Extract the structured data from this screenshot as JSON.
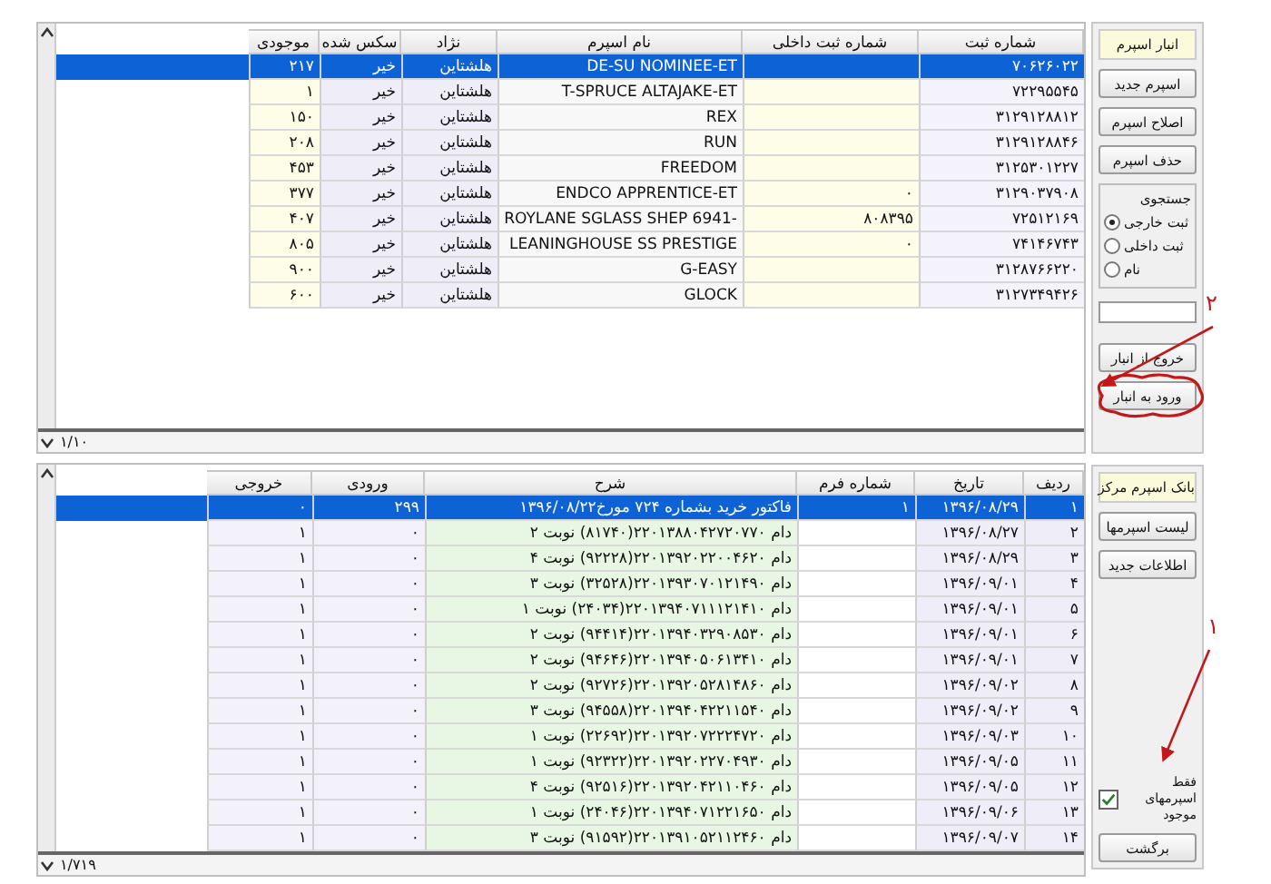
{
  "upper_grid": {
    "columns": [
      "شماره ثبت",
      "شماره ثبت داخلی",
      "نام اسپرم",
      "نژاد",
      "سکس شده",
      "موجودی"
    ],
    "rows": [
      {
        "selected": true,
        "cells": [
          "۷۰۶۲۶۰۲۲",
          "",
          "DE-SU NOMINEE-ET",
          "هلشتاین",
          "خیر",
          "۲۱۷"
        ]
      },
      {
        "selected": false,
        "cells": [
          "۷۲۲۹۵۵۴۵",
          "",
          "T-SPRUCE ALTAJAKE-ET",
          "هلشتاین",
          "خیر",
          "۱"
        ]
      },
      {
        "selected": false,
        "cells": [
          "۳۱۲۹۱۲۸۸۱۲",
          "",
          "REX",
          "هلشتاین",
          "خیر",
          "۱۵۰"
        ]
      },
      {
        "selected": false,
        "cells": [
          "۳۱۲۹۱۲۸۸۴۶",
          "",
          "RUN",
          "هلشتاین",
          "خیر",
          "۲۰۸"
        ]
      },
      {
        "selected": false,
        "cells": [
          "۳۱۲۵۳۰۱۲۲۷",
          "",
          "FREEDOM",
          "هلشتاین",
          "خیر",
          "۴۵۳"
        ]
      },
      {
        "selected": false,
        "cells": [
          "۳۱۲۹۰۳۷۹۰۸",
          "۰",
          "ENDCO APPRENTICE-ET",
          "هلشتاین",
          "خیر",
          "۳۷۷"
        ]
      },
      {
        "selected": false,
        "cells": [
          "۷۲۵۱۲۱۶۹",
          "۸۰۸۳۹۵",
          "-ROYLANE SGLASS SHEP 6941",
          "هلشتاین",
          "خیر",
          "۴۰۷"
        ]
      },
      {
        "selected": false,
        "cells": [
          "۷۴۱۴۶۷۴۳",
          "۰",
          "LEANINGHOUSE SS PRESTIGE",
          "هلشتاین",
          "خیر",
          "۸۰۵"
        ]
      },
      {
        "selected": false,
        "cells": [
          "۳۱۲۸۷۶۶۲۲۰",
          "",
          "G-EASY",
          "هلشتاین",
          "خیر",
          "۹۰۰"
        ]
      },
      {
        "selected": false,
        "cells": [
          "۳۱۲۷۳۴۹۴۲۶",
          "",
          "GLOCK",
          "هلشتاین",
          "خیر",
          "۶۰۰"
        ]
      }
    ],
    "status": "۱/۱۰"
  },
  "lower_grid": {
    "columns": [
      "ردیف",
      "تاریخ",
      "شماره فرم",
      "شرح",
      "ورودی",
      "خروجی"
    ],
    "rows": [
      {
        "selected": true,
        "cells": [
          "۱",
          "۱۳۹۶/۰۸/۲۹",
          "۱",
          "فاکتور خرید بشماره ۷۲۴ مورخ۱۳۹۶/۰۸/۲۲",
          "۲۹۹",
          "۰"
        ]
      },
      {
        "selected": false,
        "cells": [
          "۲",
          "۱۳۹۶/۰۸/۲۷",
          "",
          "دام ۲۲۰۱۳۸۸۰۴۲۷۲۰۷۷۰(۸۱۷۴۰) نوبت ۲",
          "۰",
          "۱"
        ]
      },
      {
        "selected": false,
        "cells": [
          "۳",
          "۱۳۹۶/۰۸/۲۹",
          "",
          "دام ۲۲۰۱۳۹۲۰۲۲۰۰۴۶۲۰(۹۲۲۲۸) نوبت ۴",
          "۰",
          "۱"
        ]
      },
      {
        "selected": false,
        "cells": [
          "۴",
          "۱۳۹۶/۰۹/۰۱",
          "",
          "دام ۲۲۰۱۳۹۳۰۷۰۱۲۱۴۹۰(۳۲۵۲۸) نوبت ۳",
          "۰",
          "۱"
        ]
      },
      {
        "selected": false,
        "cells": [
          "۵",
          "۱۳۹۶/۰۹/۰۱",
          "",
          "دام ۲۲۰۱۳۹۴۰۷۱۱۱۲۱۴۱۰(۲۴۰۳۴) نوبت ۱",
          "۰",
          "۱"
        ]
      },
      {
        "selected": false,
        "cells": [
          "۶",
          "۱۳۹۶/۰۹/۰۱",
          "",
          "دام ۲۲۰۱۳۹۴۰۳۲۹۰۸۵۳۰(۹۴۴۱۴) نوبت ۲",
          "۰",
          "۱"
        ]
      },
      {
        "selected": false,
        "cells": [
          "۷",
          "۱۳۹۶/۰۹/۰۱",
          "",
          "دام ۲۲۰۱۳۹۴۰۵۰۶۱۳۴۱۰(۹۴۶۴۶) نوبت ۲",
          "۰",
          "۱"
        ]
      },
      {
        "selected": false,
        "cells": [
          "۸",
          "۱۳۹۶/۰۹/۰۲",
          "",
          "دام ۲۲۰۱۳۹۲۰۵۲۸۱۴۸۶۰(۹۲۷۲۶) نوبت ۲",
          "۰",
          "۱"
        ]
      },
      {
        "selected": false,
        "cells": [
          "۹",
          "۱۳۹۶/۰۹/۰۲",
          "",
          "دام ۲۲۰۱۳۹۴۰۴۲۲۱۱۵۴۰(۹۴۵۵۸) نوبت ۳",
          "۰",
          "۱"
        ]
      },
      {
        "selected": false,
        "cells": [
          "۱۰",
          "۱۳۹۶/۰۹/۰۳",
          "",
          "دام ۲۲۰۱۳۹۲۰۷۲۲۲۴۷۲۰(۲۲۶۹۲) نوبت ۱",
          "۰",
          "۱"
        ]
      },
      {
        "selected": false,
        "cells": [
          "۱۱",
          "۱۳۹۶/۰۹/۰۵",
          "",
          "دام ۲۲۰۱۳۹۲۰۲۲۷۰۴۹۳۰(۹۲۳۲۲) نوبت ۱",
          "۰",
          "۱"
        ]
      },
      {
        "selected": false,
        "cells": [
          "۱۲",
          "۱۳۹۶/۰۹/۰۵",
          "",
          "دام ۲۲۰۱۳۹۲۰۴۲۱۱۰۴۶۰(۹۲۵۱۶) نوبت ۴",
          "۰",
          "۱"
        ]
      },
      {
        "selected": false,
        "cells": [
          "۱۳",
          "۱۳۹۶/۰۹/۰۶",
          "",
          "دام ۲۲۰۱۳۹۴۰۷۱۲۲۱۶۵۰(۲۴۰۴۶) نوبت ۱",
          "۰",
          "۱"
        ]
      },
      {
        "selected": false,
        "cells": [
          "۱۴",
          "۱۳۹۶/۰۹/۰۷",
          "",
          "دام ۲۲۰۱۳۹۱۰۵۲۱۱۲۴۶۰(۹۱۵۹۲) نوبت ۳",
          "۰",
          "۱"
        ]
      }
    ],
    "status": "۱/۷۱۹"
  },
  "sidebar": {
    "sections": [
      {
        "items": [
          {
            "kind": "label",
            "text": "انبار اسپرم"
          },
          {
            "kind": "button",
            "label": "اسپرم جدید",
            "circled": false
          },
          {
            "kind": "button",
            "label": "اصلاح اسپرم",
            "circled": false
          },
          {
            "kind": "button",
            "label": "حذف اسپرم",
            "circled": false
          },
          {
            "kind": "radio_group",
            "title": "جستجوی",
            "options": [
              {
                "label": "ثبت خارجی",
                "selected": true
              },
              {
                "label": "ثبت داخلی",
                "selected": false
              },
              {
                "label": "نام",
                "selected": false
              }
            ]
          },
          {
            "kind": "field"
          },
          {
            "kind": "button",
            "label": "خروج از انبار",
            "circled": false
          },
          {
            "kind": "button",
            "label": "ورود به انبار",
            "circled": true
          }
        ]
      },
      {
        "items": [
          {
            "kind": "label",
            "text": "بانک اسپرم مرکز"
          },
          {
            "kind": "button",
            "label": "لیست اسپرمها",
            "circled": false
          },
          {
            "kind": "button",
            "label": "اطلاعات جدید",
            "circled": false
          },
          {
            "kind": "checkbox",
            "label": "فقط اسپرمهای موجود",
            "checked": true
          },
          {
            "kind": "button",
            "label": "برگشت",
            "circled": false
          }
        ]
      }
    ]
  },
  "annotations": [
    {
      "label": "۲"
    },
    {
      "label": "۱"
    }
  ]
}
